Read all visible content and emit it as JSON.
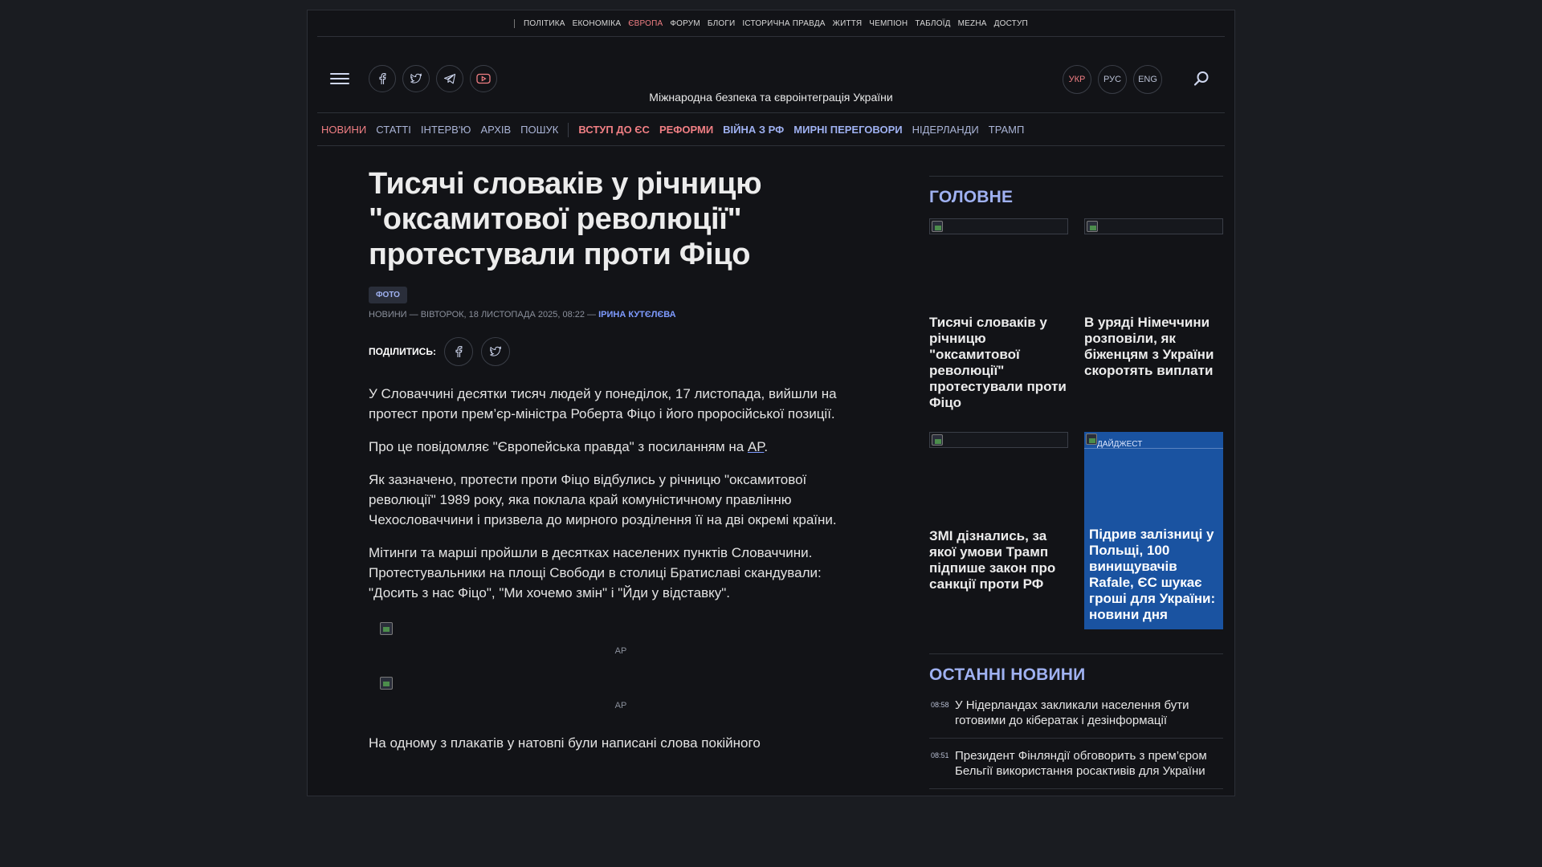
{
  "netbar": {
    "items": [
      "ПОЛІТИКА",
      "ЕКОНОМІКА",
      "ЄВРОПА",
      "ФОРУМ",
      "БЛОГИ",
      "ІСТОРИЧНА ПРАВДА",
      "ЖИТТЯ",
      "ЧЕМПІОН",
      "ТАБЛОЇД",
      "MEZHA",
      "ДОСТУП"
    ],
    "active_index": 2
  },
  "header": {
    "tagline": "Міжнародна безпека та євроінтеграція України",
    "social_icons": [
      "facebook-icon",
      "twitter-icon",
      "telegram-icon",
      "youtube-icon"
    ],
    "languages": [
      "УКР",
      "РУС",
      "ENG"
    ],
    "active_language": "УКР"
  },
  "nav": {
    "plain": [
      "НОВИНИ",
      "СТАТТІ",
      "ІНТЕРВ'Ю",
      "АРХІВ",
      "ПОШУК"
    ],
    "topics": [
      "ВСТУП ДО ЄС",
      "РЕФОРМИ",
      "ВІЙНА З РФ",
      "МИРНІ ПЕРЕГОВОРИ"
    ],
    "extra": [
      "НІДЕРЛАНДИ",
      "ТРАМП"
    ]
  },
  "article": {
    "title": "Тисячі словаків у річницю \"оксамитової революції\" протестували проти Фіцо",
    "badge": "ФОТО",
    "meta_prefix": "НОВИНИ — ВІВТОРОК, 18 ЛИСТОПАДА 2025, 08:22 — ",
    "author": "ІРИНА КУТЄЛЄВА",
    "share_label": "ПОДІЛИТИСЬ:",
    "paragraphs": [
      "У Словаччині десятки тисяч людей у понеділок, 17 листопада, вийшли на протест проти прем’єр-міністра Роберта Фіцо і його проросійської позиції.",
      "Як зазначено, протести проти Фіцо відбулись у річницю \"оксамитової революції\" 1989 року, яка поклала край комуністичному правлінню Чехословаччини і призвела до мирного розділення її на дві окремі країни.",
      "Мітинги та марші пройшли в десятках населених пунктів Словаччини. Протестувальники на площі Свободи в столиці Братиславі скандували: \"Досить з нас Фіцо\", \"Ми хочемо змін\" і \"Йди у відставку\"."
    ],
    "source_para_before": "Про це повідомляє \"Європейська правда\" з посиланням на ",
    "source_link": "AP",
    "source_para_after": ".",
    "photo_captions": [
      "AP",
      "AP"
    ],
    "last_paragraph": "На одному з плакатів у натовпі були написані слова покійного"
  },
  "sidebar": {
    "main_title": "ГОЛОВНЕ",
    "cards": [
      {
        "headline": "Тисячі словаків у річницю \"оксамитової революції\" протестували проти Фіцо"
      },
      {
        "headline": "В уряді Німеччини розповіли, як біженцям з України скоротять виплати"
      },
      {
        "headline": "ЗМІ дізнались, за якої умови Трамп підпише закон про санкції проти РФ"
      },
      {
        "label": "ДАЙДЖЕСТ",
        "headline": "Підрив залізниці у Польщі, 100 винищувачів Rafale, ЄС шукає гроші для України: новини дня"
      }
    ],
    "latest_title": "ОСТАННІ НОВИНИ",
    "latest": [
      {
        "time": "08:58",
        "text": "У Нідерландах закликали населення бути готовими до кібератак і дезінформації"
      },
      {
        "time": "08:51",
        "text": "Президент Фінляндії обговорить з прем’єром Бельгії використання росактивів для України"
      }
    ]
  },
  "colors": {
    "accent_red": "#f17f84",
    "accent_blue": "#9fb1f1",
    "digest_bg": "#1a53a1",
    "page_bg": "#121317"
  }
}
